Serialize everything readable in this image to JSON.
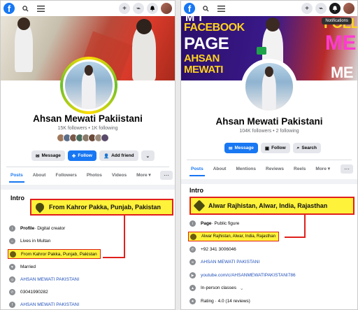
{
  "tooltip": "Notifications",
  "left": {
    "name": "Ahsan Mewati Pakiistani",
    "stats": "15K followers • 1K following",
    "buttons": {
      "message": "Message",
      "follow": "Follow",
      "add_friend": "Add friend"
    },
    "tabs": [
      "Posts",
      "About",
      "Followers",
      "Photos",
      "Videos",
      "More ▾"
    ],
    "intro_title": "Intro",
    "callout": "From Kahror Pakka, Punjab, Pakistan",
    "rows": {
      "profile_bold": "Profile",
      "profile_rest": " · Digital creator",
      "lives": "Lives in Multan",
      "from": "From Kahror Pakka, Punjab, Pakistan",
      "married": "Married",
      "instagram": "AHSAN MEWATI PAKISTANI",
      "phone": "03041990282",
      "facebook": "AHSAN MEWATI PAKISTANI"
    }
  },
  "right": {
    "cover_words": {
      "facebook": "FACEBOOK",
      "page": "PAGE",
      "ahsan": "AHSAN",
      "mewati": "MEWATI",
      "follow": "FOLLO",
      "me": "ME",
      "mt": "M T",
      "mf": "ME"
    },
    "name": "Ahsan Mewati Pakistani",
    "stats": "104K followers • 2 following",
    "buttons": {
      "message": "Message",
      "follow": "Follow",
      "search": "Search"
    },
    "tabs": [
      "Posts",
      "About",
      "Mentions",
      "Reviews",
      "Reels",
      "More ▾"
    ],
    "intro_title": "Intro",
    "callout": "Alwar Rajhistan, Alwar, India, Rajasthan",
    "rows": {
      "page_bold": "Page",
      "page_rest": " · Public figure",
      "address": "Alwar Rajhistan, Alwar, India, Rajasthan",
      "phone": "+92 341 3006046",
      "name_link": "AHSAN MEWATI PAKISTANI",
      "youtube": "youtube.com/c/AHSANMEWATIPAKISTANI786",
      "inperson": "In-person classes",
      "rating": "Rating · 4.0 (14 reviews)"
    }
  },
  "colors": {
    "accent": "#1877f2",
    "highlight": "#fff23a",
    "highlight_border": "#e0201c"
  },
  "icons": [
    "facebook-logo-icon",
    "search-icon",
    "menu-icon",
    "plus-icon",
    "messenger-icon",
    "bell-icon",
    "location-pin-icon",
    "info-icon",
    "home-icon",
    "heart-icon",
    "instagram-icon",
    "whatsapp-icon",
    "facebook-icon",
    "phone-icon",
    "link-icon",
    "youtube-icon",
    "star-icon"
  ]
}
